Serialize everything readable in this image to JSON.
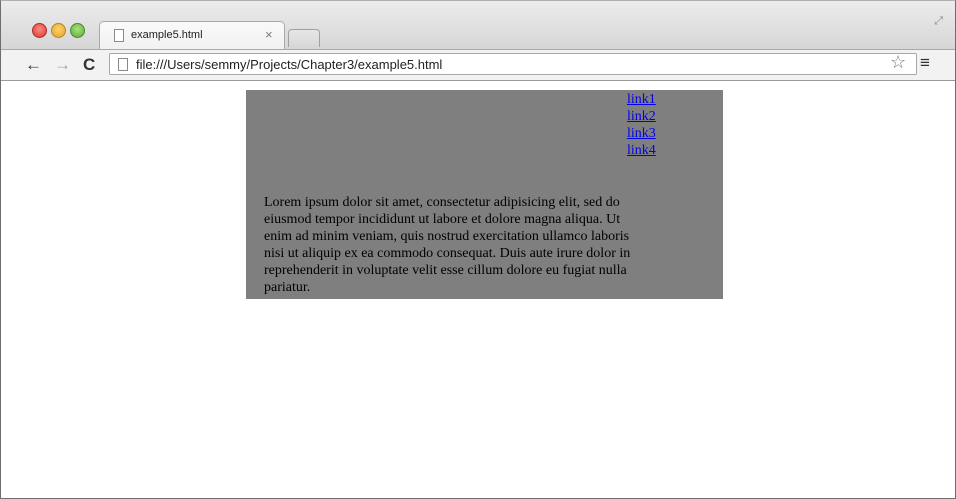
{
  "browser": {
    "tab_title": "example5.html",
    "tab_close": "×",
    "url": "file:///Users/semmy/Projects/Chapter3/example5.html",
    "icons": [
      "close-traffic-icon",
      "minimize-traffic-icon",
      "maximize-traffic-icon",
      "document-icon",
      "back-arrow-icon",
      "forward-arrow-icon",
      "reload-icon",
      "star-icon",
      "menu-icon",
      "fullscreen-icon"
    ]
  },
  "page": {
    "links": [
      "link1",
      "link2",
      "link3",
      "link4"
    ],
    "body_text": "Lorem ipsum dolor sit amet, consectetur adipisicing elit, sed do eiusmod tempor incididunt ut labore et dolore magna aliqua. Ut enim ad minim veniam, quis nostrud exercitation ullamco laboris nisi ut aliquip ex ea commodo consequat. Duis aute irure dolor in reprehenderit in voluptate velit esse cillum dolore eu fugiat nulla pariatur.",
    "box_color": "#7f7f7f",
    "link_color": "#0000ee"
  }
}
